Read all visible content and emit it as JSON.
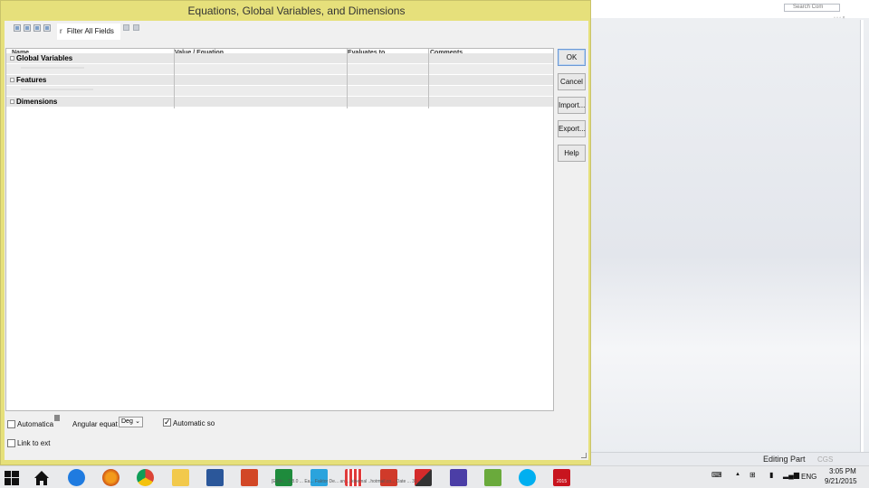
{
  "dialog": {
    "title": "Equations, Global Variables, and Dimensions",
    "filter": {
      "lead": "r",
      "label": "Filter All Fields"
    },
    "columns": [
      "Name",
      "Value / Equation",
      "Evaluates to",
      "Comments"
    ],
    "sections": [
      "Global Variables",
      "Features",
      "Dimensions"
    ],
    "buttons": {
      "ok": "OK",
      "cancel": "Cancel",
      "import": "Import...",
      "export": "Export...",
      "help": "Help"
    },
    "options": {
      "automatic_rebuild": "Automatica",
      "angular_units_label": "Angular equat",
      "angular_units_value": "Deg",
      "automatic_solve": "Automatic so",
      "automatic_solve_checked": true,
      "link_external": "Link to ext"
    }
  },
  "background_app": {
    "search_placeholder": "Search Com",
    "status": "Editing Part",
    "units": "CGS"
  },
  "taskbar": {
    "apps": [
      "start",
      "home",
      "internet-explorer",
      "firefox",
      "chrome",
      "file-explorer",
      "word",
      "powerpoint",
      "excel",
      "store",
      "apps",
      "unknown-red",
      "antivirus",
      "settings",
      "network",
      "skype",
      "solidworks"
    ],
    "solidworks_badge": "2015",
    "marquee": "[Ed|in... 2.8.0 ... Ea... Faktor De... an ... kinemal ..hotmail.co... Date ... 31 -",
    "lang": "ENG",
    "time": "3:05 PM",
    "date": "9/21/2015",
    "colors": {
      "accent_yellow": "#e6e07b",
      "taskbar": "#e9eaec"
    }
  }
}
